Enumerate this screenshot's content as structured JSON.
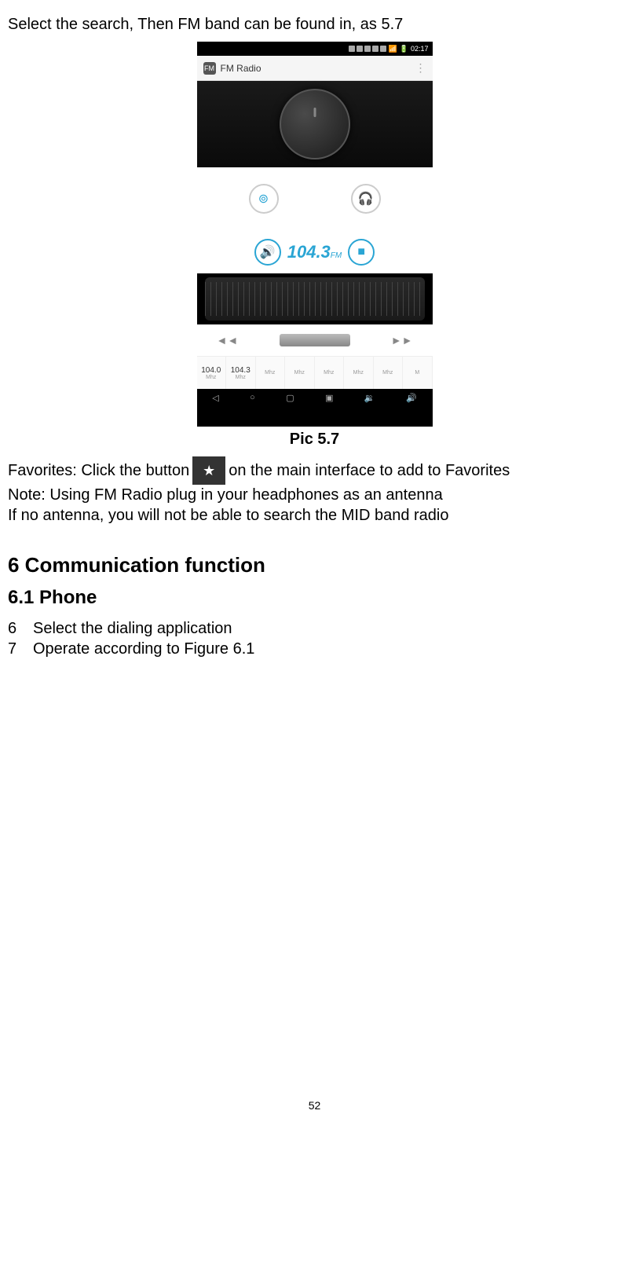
{
  "intro_text": "Select the search, Then FM band can be found in, as 5.7",
  "screenshot": {
    "status_time": "02:17",
    "app_header_icon_text": "FM",
    "app_header_title": "FM Radio",
    "app_header_menu": "⋮",
    "frequency_value": "104.3",
    "frequency_unit": "FM",
    "presets": [
      {
        "freq": "104.0",
        "label": "Mhz"
      },
      {
        "freq": "104.3",
        "label": "Mhz"
      },
      {
        "freq": "",
        "label": "Mhz"
      },
      {
        "freq": "",
        "label": "Mhz"
      },
      {
        "freq": "",
        "label": "Mhz"
      },
      {
        "freq": "",
        "label": "Mhz"
      },
      {
        "freq": "",
        "label": "Mhz"
      },
      {
        "freq": "",
        "label": "M"
      }
    ]
  },
  "caption": "Pic 5.7",
  "favorites_prefix": "Favorites: Click the button",
  "favorites_suffix": "on the main interface to add to Favorites",
  "note_line1": "Note: Using FM Radio plug in your headphones as an antenna",
  "note_line2": "If no antenna, you will not be able to search the MID band radio",
  "section_heading": "6 Communication function",
  "subsection_heading": "6.1 Phone",
  "list_items": [
    {
      "num": "6",
      "text": "Select the dialing application"
    },
    {
      "num": "7",
      "text": "Operate according to Figure 6.1"
    }
  ],
  "page_number": "52"
}
